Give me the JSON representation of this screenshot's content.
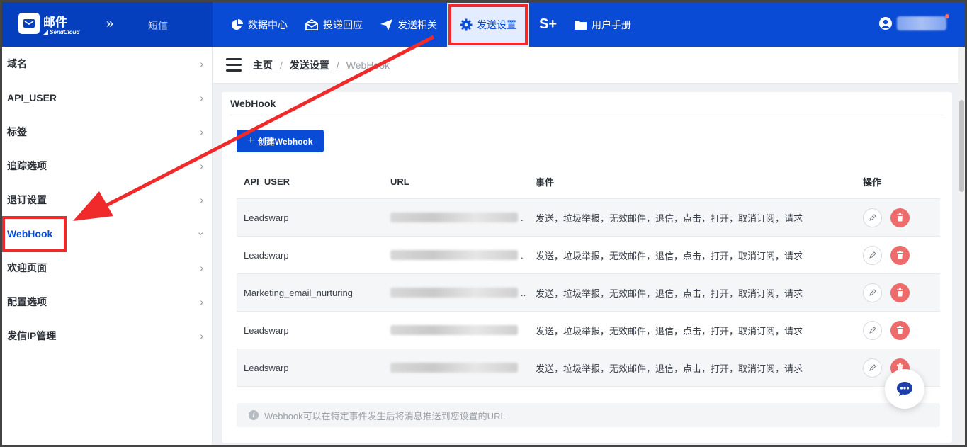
{
  "brand": {
    "name": "邮件",
    "sub": "SendCloud",
    "sms": "短信"
  },
  "nav": [
    {
      "label": "数据中心"
    },
    {
      "label": "投递回应"
    },
    {
      "label": "发送相关"
    },
    {
      "label": "发送设置"
    },
    {
      "label": "S+"
    },
    {
      "label": "用户手册"
    }
  ],
  "sidebar": {
    "items": [
      {
        "label": "域名"
      },
      {
        "label": "API_USER"
      },
      {
        "label": "标签"
      },
      {
        "label": "追踪选项"
      },
      {
        "label": "退订设置"
      },
      {
        "label": "WebHook"
      },
      {
        "label": "欢迎页面"
      },
      {
        "label": "配置选项"
      },
      {
        "label": "发信IP管理"
      }
    ]
  },
  "breadcrumb": {
    "home": "主页",
    "section": "发送设置",
    "current": "WebHook"
  },
  "card": {
    "title": "WebHook",
    "create_label": "创建Webhook",
    "columns": {
      "api_user": "API_USER",
      "url": "URL",
      "events": "事件",
      "actions": "操作"
    },
    "rows": [
      {
        "api_user": "Leadswarp",
        "events": "发送，垃圾举报，无效邮件，退信，点击，打开，取消订阅，请求"
      },
      {
        "api_user": "Leadswarp",
        "events": "发送，垃圾举报，无效邮件，退信，点击，打开，取消订阅，请求"
      },
      {
        "api_user": "Marketing_email_nurturing",
        "events": "发送，垃圾举报，无效邮件，退信，点击，打开，取消订阅，请求"
      },
      {
        "api_user": "Leadswarp",
        "events": "发送，垃圾举报，无效邮件，退信，点击，打开，取消订阅，请求"
      },
      {
        "api_user": "Leadswarp",
        "events": "发送，垃圾举报，无效邮件，退信，点击，打开，取消订阅，请求"
      }
    ],
    "tip": "Webhook可以在特定事件发生后将消息推送到您设置的URL"
  },
  "colors": {
    "brand_blue": "#0a4bd6",
    "highlight_red": "#f02a2a",
    "delete_red": "#ee6b6b"
  }
}
